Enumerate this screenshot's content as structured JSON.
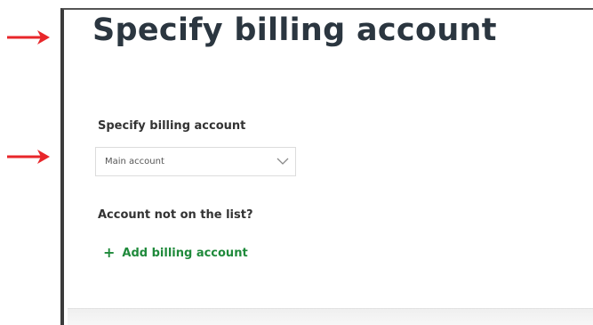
{
  "page": {
    "title": "Specify billing account"
  },
  "billing": {
    "label": "Specify billing account",
    "selected": "Main account",
    "not_listed_text": "Account not on the list?",
    "add_link_label": "Add billing account",
    "add_icon": "plus-icon",
    "dropdown_icon": "chevron-down-icon"
  },
  "annotations": {
    "arrow_icon": "arrow-right-icon",
    "arrow_color": "#e8262a"
  },
  "colors": {
    "link": "#1f8a3b",
    "title": "#2b3640"
  }
}
